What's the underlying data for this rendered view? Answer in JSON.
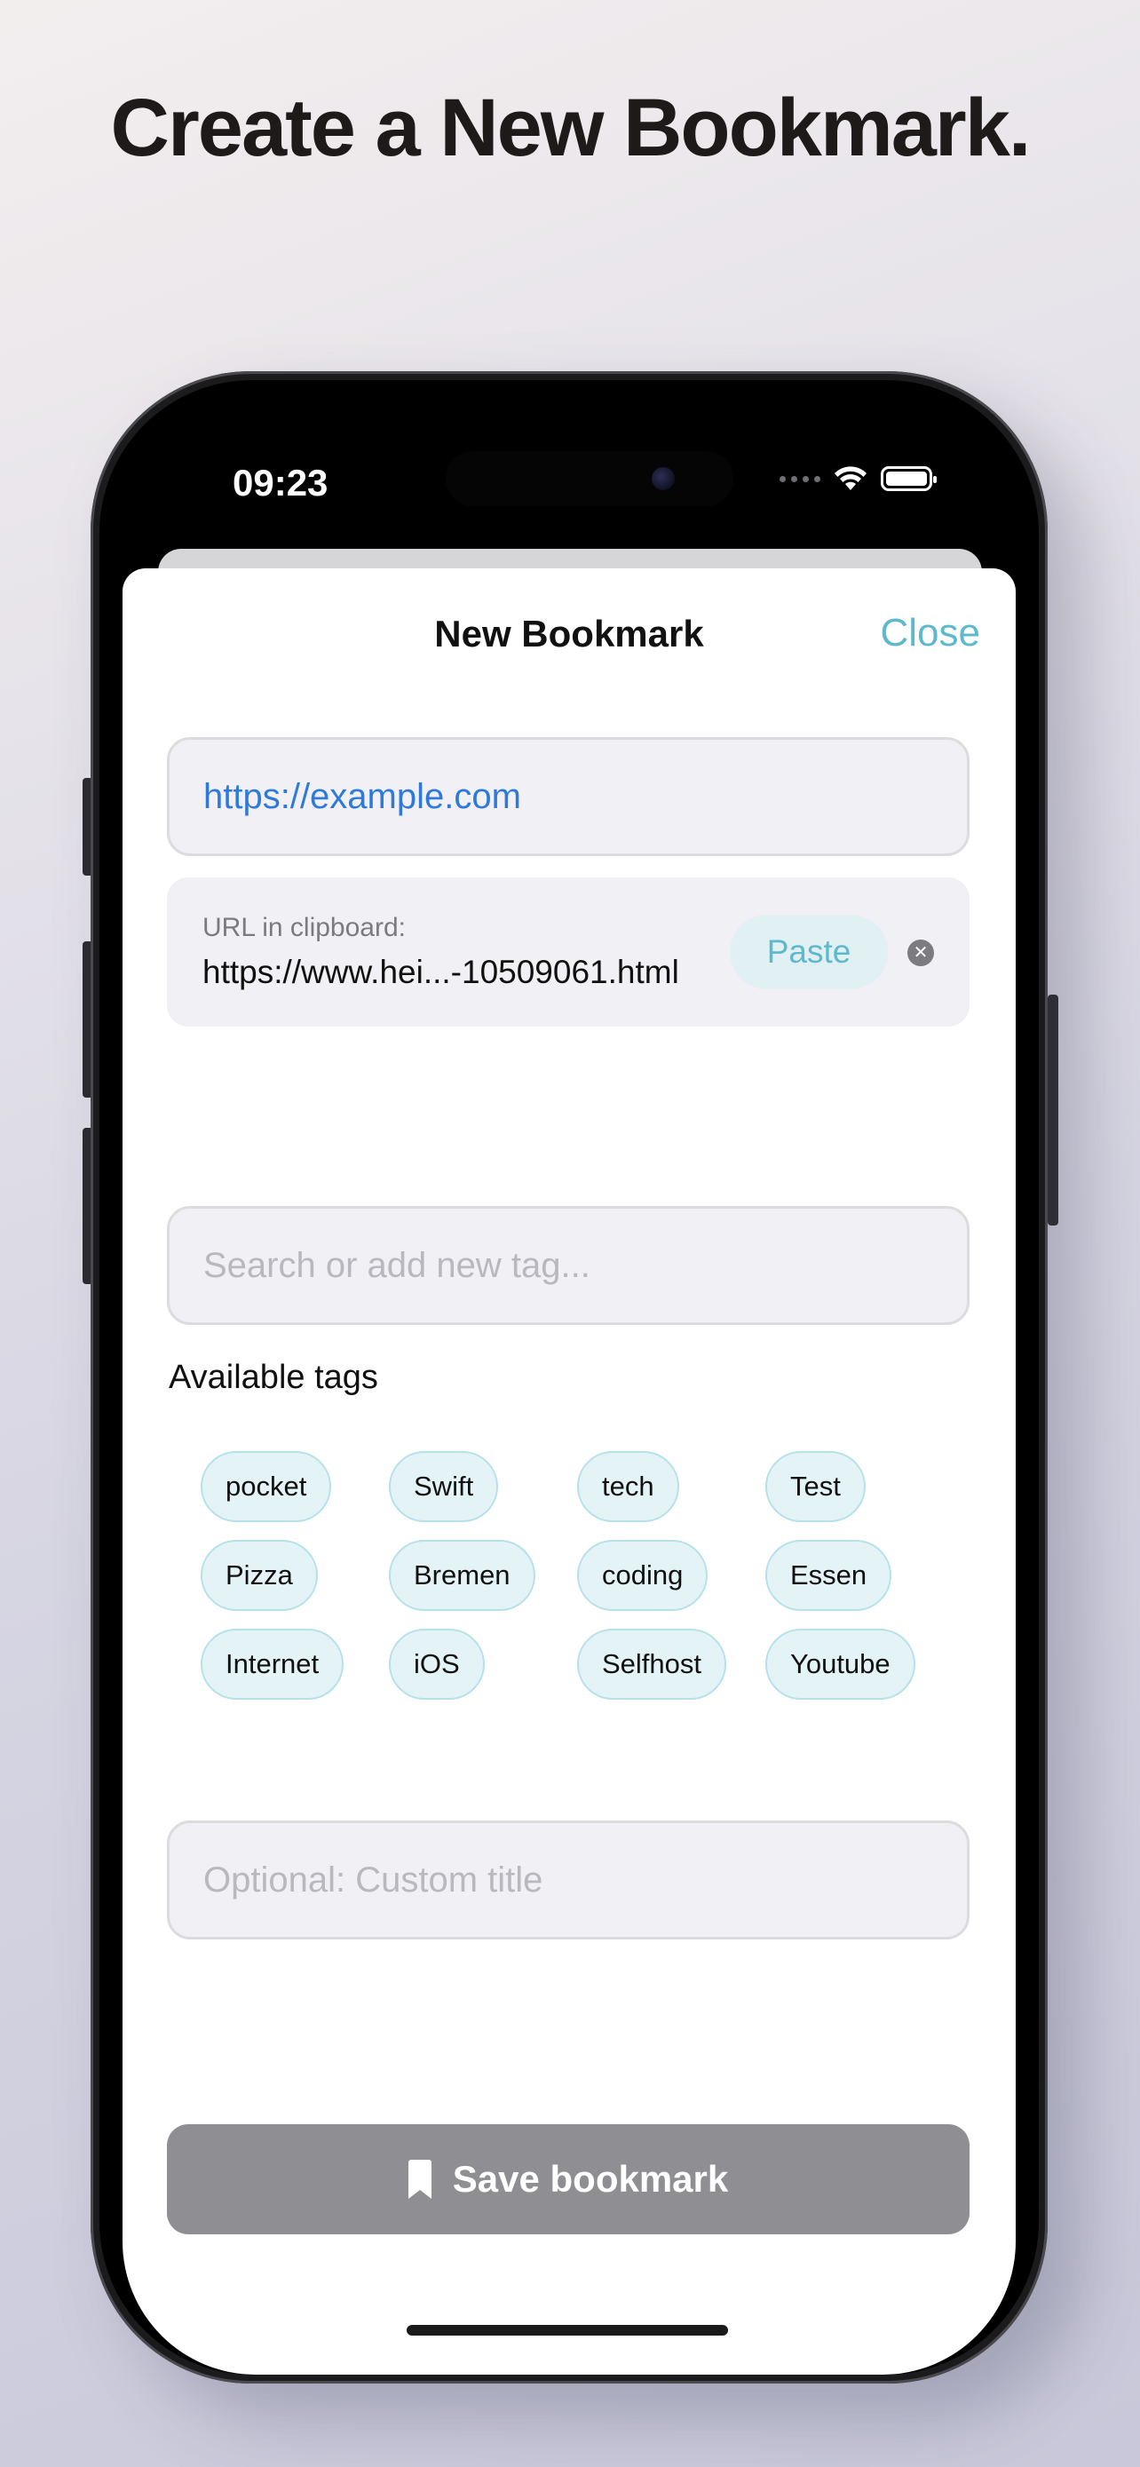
{
  "headline": "Create a New Bookmark.",
  "status_bar": {
    "time": "09:23",
    "icons": [
      "cellular-dots-icon",
      "wifi-icon",
      "battery-icon"
    ]
  },
  "nav": {
    "title": "New Bookmark",
    "close_label": "Close"
  },
  "url_field": {
    "value": "https://example.com"
  },
  "clipboard": {
    "label": "URL in clipboard:",
    "url": "https://www.hei...-10509061.html",
    "paste_label": "Paste"
  },
  "tag_search": {
    "placeholder": "Search or add new tag..."
  },
  "tags": {
    "heading": "Available tags",
    "items": [
      "pocket",
      "Swift",
      "tech",
      "Test",
      "Pizza",
      "Bremen",
      "coding",
      "Essen",
      "Internet",
      "iOS",
      "Selfhost",
      "Youtube"
    ]
  },
  "custom_title": {
    "placeholder": "Optional: Custom title"
  },
  "save": {
    "label": "Save bookmark",
    "icon": "bookmark-icon"
  },
  "colors": {
    "accent": "#5fb9cc",
    "link": "#2f7ad8",
    "save_disabled": "#8e8e93",
    "chip_bg": "#e3f3f6"
  }
}
